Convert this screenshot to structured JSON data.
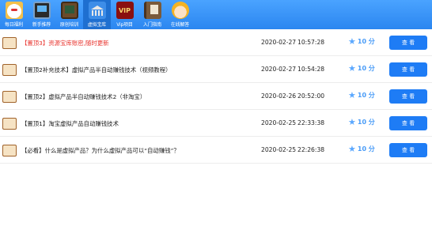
{
  "toolbar": {
    "items": [
      {
        "label": "每日福利",
        "icon": "lucky-cat-icon",
        "active": false
      },
      {
        "label": "新手推荐",
        "icon": "monitor-icon",
        "active": false
      },
      {
        "label": "原创培训",
        "icon": "blackboard-icon",
        "active": false
      },
      {
        "label": "虚拟宝库",
        "icon": "bank-icon",
        "active": true
      },
      {
        "label": "Vip项目",
        "icon": "vip-icon",
        "active": false,
        "icon_text": "VIP"
      },
      {
        "label": "入门指南",
        "icon": "book-icon",
        "active": false
      },
      {
        "label": "在线解答",
        "icon": "support-girl-icon",
        "active": false
      }
    ]
  },
  "list": {
    "rows": [
      {
        "title": "【置顶3】资源宝库账密,随时更新",
        "highlight": true,
        "date": "2020-02-27",
        "time": "10:57:28",
        "score": "10 分",
        "button": "查 看"
      },
      {
        "title": "【置顶2补充技术】虚拟产品半自动赚钱技术（视频教程）",
        "highlight": false,
        "date": "2020-02-27",
        "time": "10:54:28",
        "score": "10 分",
        "button": "查 看"
      },
      {
        "title": "【置顶2】虚拟产品半自动赚钱技术2（非淘宝）",
        "highlight": false,
        "date": "2020-02-26",
        "time": "20:52:00",
        "score": "10 分",
        "button": "查 看"
      },
      {
        "title": "【置顶1】淘宝虚拟产品自动赚钱技术",
        "highlight": false,
        "date": "2020-02-25",
        "time": "22:33:38",
        "score": "10 分",
        "button": "查 看"
      },
      {
        "title": "【必看】什么是虚拟产品？为什么虚拟产品可以“自动赚钱”？",
        "highlight": false,
        "date": "2020-02-25",
        "time": "22:26:38",
        "score": "10 分",
        "button": "查 看"
      }
    ]
  },
  "colors": {
    "toolbar": "#3a96f8",
    "active_tab": "#1e6fd0",
    "button": "#1e7cf5",
    "highlight_title": "#e8312b",
    "star": "#5ba8ff"
  }
}
